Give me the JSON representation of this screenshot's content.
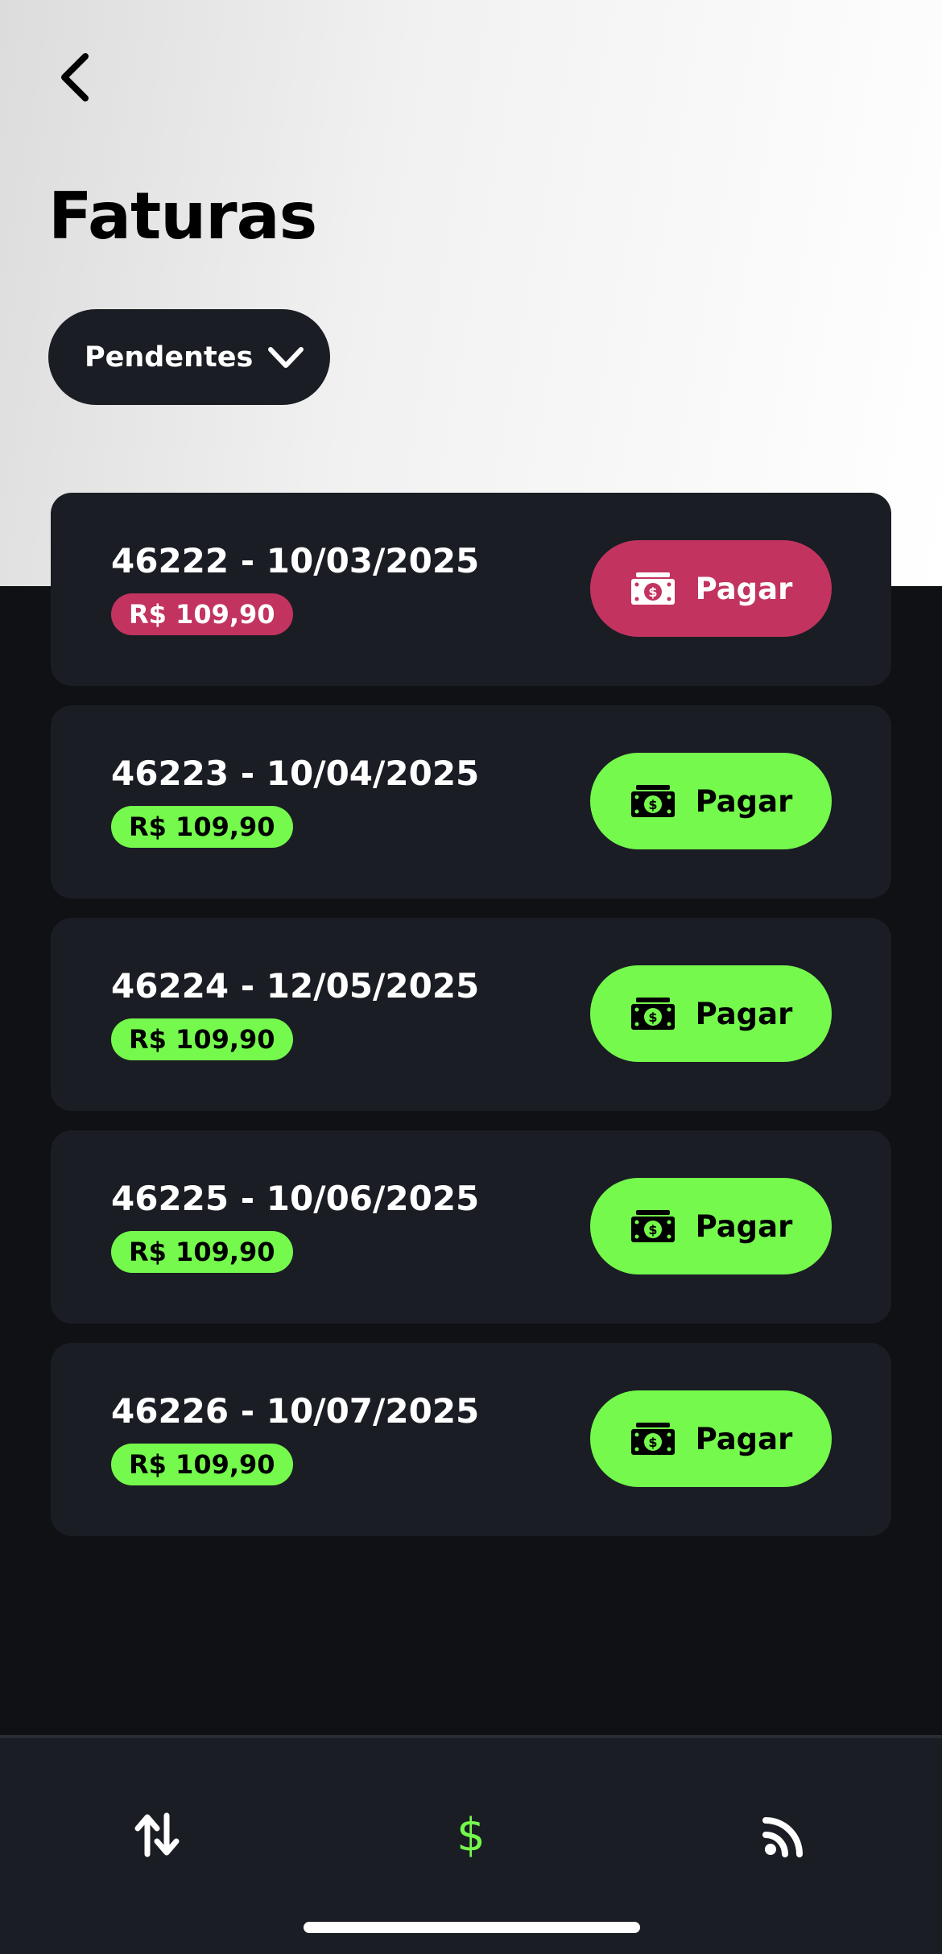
{
  "header": {
    "title": "Faturas",
    "back_icon": "chevron-left-icon",
    "filter": {
      "label": "Pendentes",
      "icon": "chevron-down-icon"
    }
  },
  "invoices": [
    {
      "title": "46222 - 10/03/2025",
      "amount": "R$ 109,90",
      "button_label": "Pagar",
      "status": "overdue",
      "color": "#c2345f",
      "text_color": "#ffffff"
    },
    {
      "title": "46223 - 10/04/2025",
      "amount": "R$ 109,90",
      "button_label": "Pagar",
      "status": "pending",
      "color": "#74f94c",
      "text_color": "#000000"
    },
    {
      "title": "46224 - 12/05/2025",
      "amount": "R$ 109,90",
      "button_label": "Pagar",
      "status": "pending",
      "color": "#74f94c",
      "text_color": "#000000"
    },
    {
      "title": "46225 - 10/06/2025",
      "amount": "R$ 109,90",
      "button_label": "Pagar",
      "status": "pending",
      "color": "#74f94c",
      "text_color": "#000000"
    },
    {
      "title": "46226 - 10/07/2025",
      "amount": "R$ 109,90",
      "button_label": "Pagar",
      "status": "pending",
      "color": "#74f94c",
      "text_color": "#000000"
    }
  ],
  "bottom_nav": {
    "items": [
      {
        "icon": "transfer-arrows-icon",
        "active": false
      },
      {
        "icon": "dollar-sign-icon",
        "label": "$",
        "active": true
      },
      {
        "icon": "feed-icon",
        "active": false
      }
    ]
  },
  "colors": {
    "accent": "#74f94c",
    "overdue": "#c2345f",
    "card_bg": "#1b1d24",
    "page_bg": "#0f1115"
  }
}
